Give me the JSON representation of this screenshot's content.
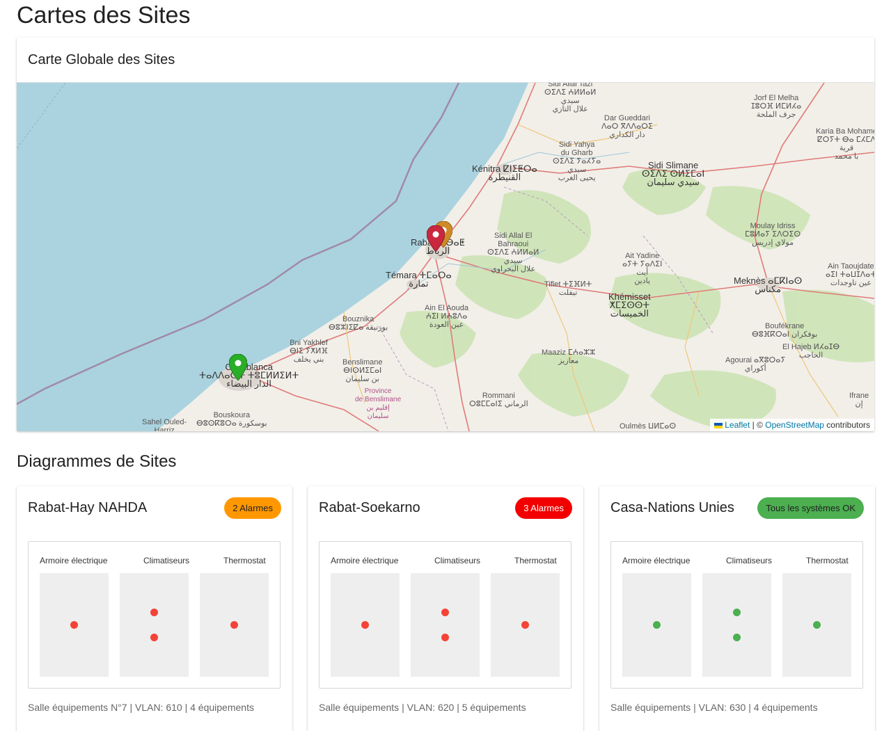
{
  "page": {
    "title": "Cartes des Sites"
  },
  "map_card": {
    "title": "Carte Globale des Sites",
    "labels": {
      "sidi_allal_tazi": "Sidi Allal Tazi\nⵙⵉⴷⵉ ⵄⵍⵍⴰⵍ\nسيدي\nعلال التازي",
      "dar_gueddari": "Dar Gueddari\nⴷⴰⵔ ⴳⴷⴷⴰⵔⵉ\nدار الكداري",
      "jorf_el_melha": "Jorf El Melha\nⵊⵓⵔⴼ ⵍⵎⵍⵃⴰ\nجرف الملحة",
      "karia_ba_mohamed": "Karia Ba Mohame\nⵇⵔⵢⵜ ⴱⴰ ⵎⵃⵎⴷ\nقرية\nبا محمد",
      "sidi_yahya": "Sidi Yahya\ndu Gharb\nⵙⵉⴷⵉ ⵢⴰⵃⵢⴰ\nسيدي\nيحيى الغرب",
      "kenitra": "Kénitra ⵇⵏⵉⵟⵔⴰ\nالقنيطرة",
      "sidi_slimane": "Sidi Slimane\nⵙⵉⴷⵉ ⵙⵍⵉⵎⴰⵏ\nسيدي سليمان",
      "moulay_idriss": "Moulay Idriss\nⵎⵓⵍⴰⵢ ⵉⴷⵔⵉⵙ\nمولاي إدريس",
      "rabat": "Rabat ⵔⴱⴰⵟ\nالرباط",
      "sidi_allal_bahraoui": "Sidi Allal El\nBahraoui\nⵙⵉⴷⵉ ⵄⵍⵍⴰⵍ\nسيدي\nعلال البحراوي",
      "ait_yadine": "Ait Yadine\nⴰⵢⵜ ⵢⴰⴷⵉⵏ\nأيت\nيادين",
      "ain_taoujdate": "Ain Taoujdate\nⴰⵉⵏ ⵜⴰⵡⵊⴷⴰⵜ\nعين تاوجدات",
      "temara": "Témara ⵜⵎⴰⵔⴰ\nتمارة",
      "tiflet": "Tiflet ⵜⵉⴼⵍⵜ\nتيفلت",
      "khemisset": "Khémisset\nⵅⵎⵉⵙⵙⵜ\nالخميسات",
      "meknes": "Meknès ⴰⵎⴽⵏⴰⵙ\nمكناس",
      "ain_el_aouda": "Ain El Aouda\nⵄⵉⵏ ⵍⵄⵓⴷⴰ\nعين العودة",
      "bouznika": "Bouznika\nⴱⵓⵣⵏⵉⵇⴰ بوزنيقة",
      "boufekrane": "Boufékrane\nⴱⵓⴼⴽⵔⴰⵏ بوفكران",
      "bni_yakhlef": "Bni Yakhlef\nⴱⵏⵉ ⵢⵅⵍⴼ\nبني يخلف",
      "el_hajeb": "El Hajeb ⵍⵃⴰⵊⴱ\nالحاجب",
      "benslimane": "Benslimane\nⴱⵏⵙⵍⵉⵎⴰⵏ\nبن سليمان",
      "maaziz": "Maaziz ⵎⵄⴰⵣⵣ\nمعازيز",
      "agourai": "Agourai ⴰⴳⵓⵔⴰⵢ\nأكوراي",
      "casablanca": "Casablanca\nⵜⴰⴷⴷⴰⵔⵜ ⵜⵓⵎⵍⵍⵉⵍⵜ\nالدار البيضاء",
      "province_benslimane": "Province\nde Benslimane\nإقليم بن\nسليمان",
      "rommani": "Rommani\nⵔⵓⵎⵎⴰⵏⵉ الرماني",
      "ifrane": "Ifrane\nإن",
      "bouskoura": "Bouskoura\nⴱⵓⵙⴽⵓⵔⴰ بوسكورة",
      "sahel_ouled": "Sahel Ouled-\nHarriz",
      "oulmes": "Oulmès ⵡⵍⵎⴰⵙ"
    },
    "attribution": {
      "leaflet": "Leaflet",
      "separator": " | © ",
      "osm": "OpenStreetMap",
      "suffix": " contributors"
    }
  },
  "sites_section": {
    "title": "Diagrammes de Sites"
  },
  "sites": [
    {
      "name": "Rabat-Hay NAHDA",
      "badge": "2 Alarmes",
      "badge_color": "#ff9800",
      "columns": [
        "Armoire électrique",
        "Climatiseurs",
        "Thermostat"
      ],
      "dots": [
        [
          "red"
        ],
        [
          "red",
          "red"
        ],
        [
          "red"
        ]
      ],
      "footer": "Salle équipements N°7 | VLAN: 610 | 4 équipements"
    },
    {
      "name": "Rabat-Soekarno",
      "badge": "3 Alarmes",
      "badge_color": "#f20000",
      "columns": [
        "Armoire électrique",
        "Climatiseurs",
        "Thermostat"
      ],
      "dots": [
        [
          "red"
        ],
        [
          "red",
          "red"
        ],
        [
          "red"
        ]
      ],
      "footer": "Salle équipements | VLAN: 620 | 5 équipements"
    },
    {
      "name": "Casa-Nations Unies",
      "badge": "Tous les systèmes OK",
      "badge_color": "#4caf50",
      "columns": [
        "Armoire électrique",
        "Climatiseurs",
        "Thermostat"
      ],
      "dots": [
        [
          "green"
        ],
        [
          "green",
          "green"
        ],
        [
          "green"
        ]
      ],
      "footer": "Salle équipements | VLAN: 630 | 4 équipements"
    }
  ],
  "colors": {
    "ocean": "#aad3df",
    "land": "#f2efe9",
    "alarm_red": "#f44336",
    "ok_green": "#4caf50",
    "marker_red": "#c9283e",
    "marker_orange": "#cf8a28",
    "marker_green": "#2aad27"
  }
}
